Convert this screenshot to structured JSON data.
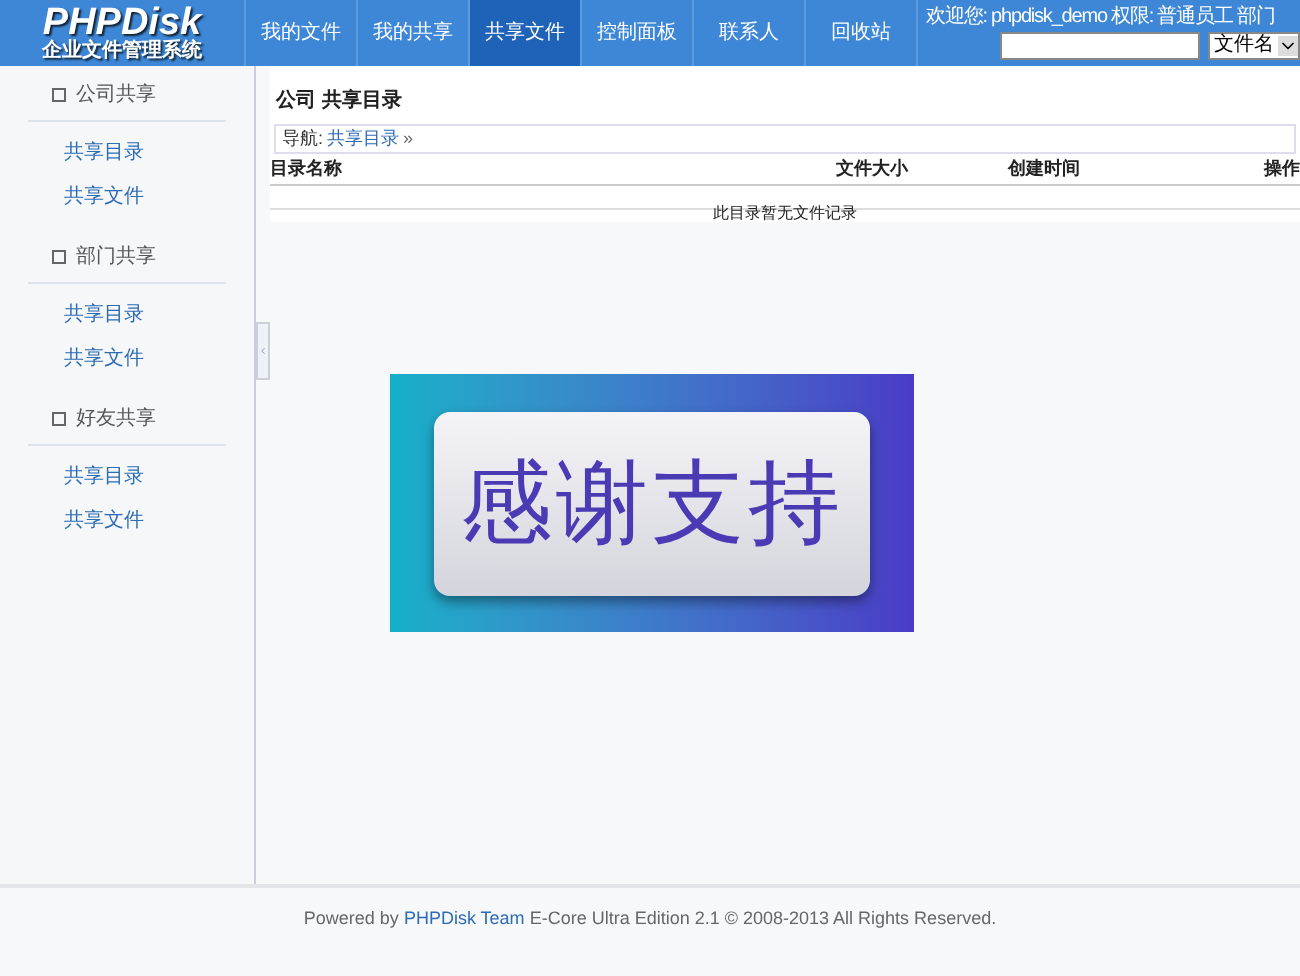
{
  "logo": {
    "title": "PHPDisk",
    "subtitle": "企业文件管理系统"
  },
  "nav": [
    {
      "label": "我的文件",
      "selected": false
    },
    {
      "label": "我的共享",
      "selected": false
    },
    {
      "label": "共享文件",
      "selected": true
    },
    {
      "label": "控制面板",
      "selected": false
    },
    {
      "label": "联系人",
      "selected": false
    },
    {
      "label": "回收站",
      "selected": false
    }
  ],
  "user_info": "欢迎您: phpdisk_demo 权限: 普通员工 部门",
  "search": {
    "select": "文件名"
  },
  "sidebar": [
    {
      "title": "公司共享",
      "items": [
        "共享目录",
        "共享文件"
      ]
    },
    {
      "title": "部门共享",
      "items": [
        "共享目录",
        "共享文件"
      ]
    },
    {
      "title": "好友共享",
      "items": [
        "共享目录",
        "共享文件"
      ]
    }
  ],
  "page_title": "公司 共享目录",
  "breadcrumb": {
    "label": "导航:",
    "link": "共享目录",
    "separator": "»"
  },
  "table": {
    "columns": [
      "目录名称",
      "文件大小",
      "创建时间",
      "操作"
    ],
    "empty": "此目录暂无文件记录"
  },
  "banner": "感谢支持",
  "footer": {
    "before": "Powered by",
    "link": "PHPDisk Team",
    "after": "E-Core Ultra Edition 2.1 © 2008-2013 All Rights Reserved."
  }
}
